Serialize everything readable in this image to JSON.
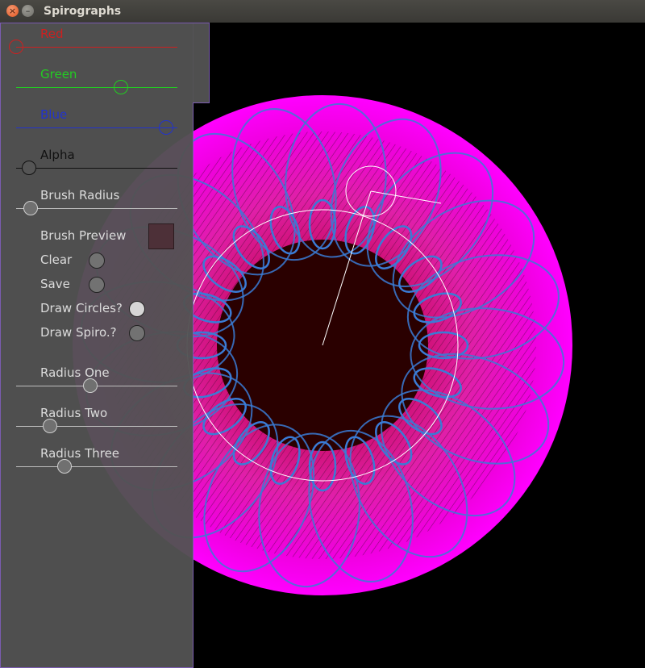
{
  "window": {
    "title": "Spirographs",
    "close_icon": "×",
    "minimize_icon": "–"
  },
  "controls": {
    "red": {
      "label": "Red",
      "value": 0.0,
      "color": "#cc2020"
    },
    "green": {
      "label": "Green",
      "value": 0.65,
      "color": "#22cc22"
    },
    "blue": {
      "label": "Blue",
      "value": 0.93,
      "color": "#2233cc"
    },
    "alpha": {
      "label": "Alpha",
      "value": 0.08,
      "color": "#000000"
    },
    "brush_radius": {
      "label": "Brush Radius",
      "value": 0.09
    },
    "brush_preview": {
      "label": "Brush Preview",
      "color": "#4d3038"
    },
    "clear": {
      "label": "Clear"
    },
    "save": {
      "label": "Save"
    },
    "draw_circles": {
      "label": "Draw Circles?",
      "checked": true
    },
    "draw_spiro": {
      "label": "Draw Spiro.?",
      "checked": false
    },
    "radius_one": {
      "label": "Radius One",
      "value": 0.46
    },
    "radius_two": {
      "label": "Radius Two",
      "value": 0.21
    },
    "radius_three": {
      "label": "Radius Three",
      "value": 0.3
    }
  },
  "palette": {
    "magenta": "#ff00ff",
    "spiro_line": "#3a7bd5",
    "center": "#2a0000",
    "guide": "#ffffff"
  }
}
